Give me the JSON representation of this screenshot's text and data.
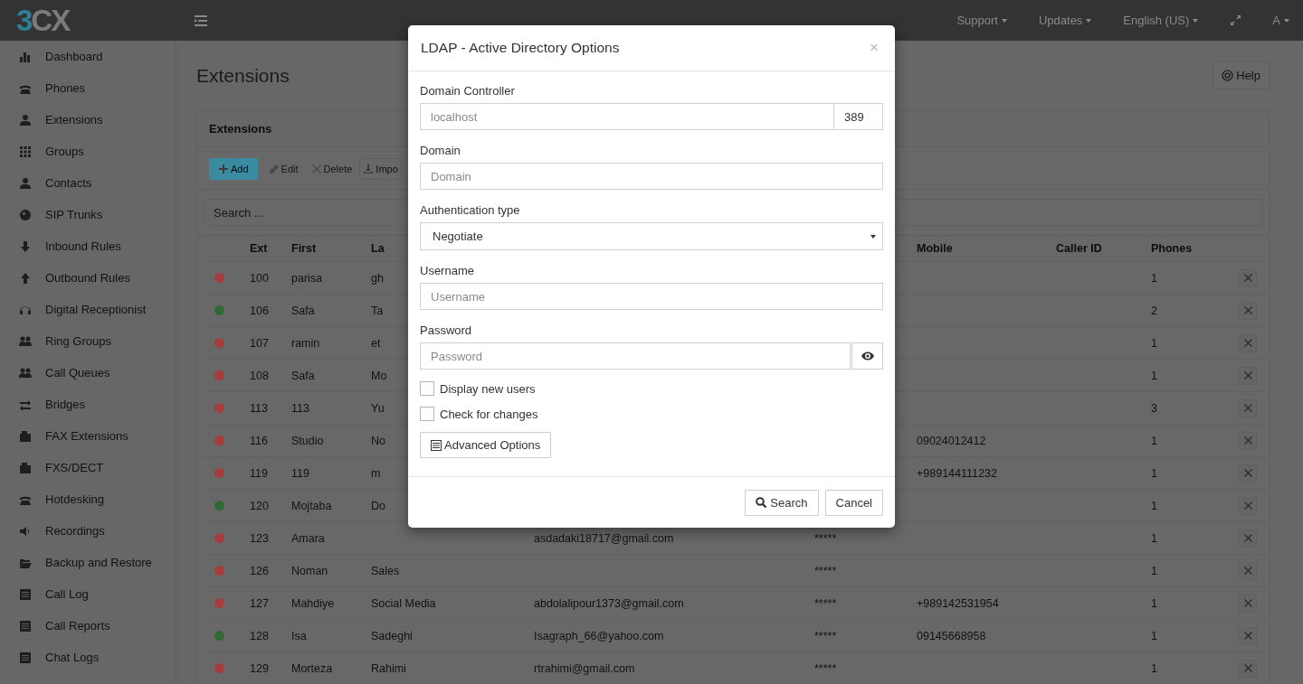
{
  "topbar": {
    "logo": [
      "3",
      "CX"
    ],
    "menus": [
      {
        "label": "Support"
      },
      {
        "label": "Updates"
      },
      {
        "label": "English (US)"
      },
      {
        "label": "A"
      }
    ]
  },
  "sidebar": {
    "items": [
      {
        "label": "Dashboard"
      },
      {
        "label": "Phones"
      },
      {
        "label": "Extensions"
      },
      {
        "label": "Groups"
      },
      {
        "label": "Contacts"
      },
      {
        "label": "SIP Trunks"
      },
      {
        "label": "Inbound Rules"
      },
      {
        "label": "Outbound Rules"
      },
      {
        "label": "Digital Receptionist"
      },
      {
        "label": "Ring Groups"
      },
      {
        "label": "Call Queues"
      },
      {
        "label": "Bridges"
      },
      {
        "label": "FAX Extensions"
      },
      {
        "label": "FXS/DECT"
      },
      {
        "label": "Hotdesking"
      },
      {
        "label": "Recordings"
      },
      {
        "label": "Backup and Restore"
      },
      {
        "label": "Call Log"
      },
      {
        "label": "Call Reports"
      },
      {
        "label": "Chat Logs"
      }
    ]
  },
  "page": {
    "title": "Extensions",
    "help_button": "Help"
  },
  "panel": {
    "title": "Extensions",
    "toolbar": [
      "Add",
      "Edit",
      "Delete",
      "Impo"
    ],
    "search": {
      "placeholder": "Search ..."
    }
  },
  "table": {
    "columns": [
      "Ext",
      "First",
      "La",
      "Mobile",
      "Caller ID",
      "Phones"
    ],
    "rows": [
      {
        "color": "#a63c3c",
        "ext": "100",
        "first": "parisa",
        "last": "gh",
        "email": "",
        "column_6": "",
        "mobile": "",
        "phones": "1"
      },
      {
        "color": "#2f6b32",
        "ext": "106",
        "first": "Safa",
        "last": "Ta",
        "email": "",
        "column_6": "",
        "mobile": "",
        "phones": "2"
      },
      {
        "color": "#a63c3c",
        "ext": "107",
        "first": "ramin",
        "last": "et",
        "email": "",
        "column_6": "",
        "mobile": "",
        "phones": "1"
      },
      {
        "color": "#a63c3c",
        "ext": "108",
        "first": "Safa",
        "last": "Mo",
        "email": "",
        "column_6": "",
        "mobile": "",
        "phones": "1"
      },
      {
        "color": "#a63c3c",
        "ext": "113",
        "first": "113",
        "last": "Yu",
        "email": "",
        "column_6": "",
        "mobile": "",
        "phones": "3"
      },
      {
        "color": "#a63c3c",
        "ext": "116",
        "first": "Studio",
        "last": "No",
        "email": "",
        "column_6": "",
        "mobile": "09024012412",
        "phones": "1"
      },
      {
        "color": "#a63c3c",
        "ext": "119",
        "first": "119",
        "last": "m",
        "email": "",
        "column_6": "",
        "mobile": "+989144111232",
        "phones": "1"
      },
      {
        "color": "#2f6b32",
        "ext": "120",
        "first": "Mojtaba",
        "last": "Do",
        "email": "",
        "column_6": "",
        "mobile": "",
        "phones": "1"
      },
      {
        "color": "#a63c3c",
        "ext": "123",
        "first": "Amara",
        "last": "",
        "email": "asdadaki18717@gmail.com",
        "column_6": "*****",
        "mobile": "",
        "phones": "1"
      },
      {
        "color": "#a63c3c",
        "ext": "126",
        "first": "Noman",
        "last": "Sales",
        "email": "",
        "column_6": "*****",
        "mobile": "",
        "phones": "1"
      },
      {
        "color": "#a63c3c",
        "ext": "127",
        "first": "Mahdiye",
        "last": "Social Media",
        "email": "abdolalipour1373@gmail.com",
        "column_6": "*****",
        "mobile": "+989142531954",
        "phones": "1"
      },
      {
        "color": "#2f6b32",
        "ext": "128",
        "first": "Isa",
        "last": "Sadeghi",
        "email": "Isagraph_66@yahoo.com",
        "column_6": "*****",
        "mobile": "09145668958",
        "phones": "1"
      },
      {
        "color": "#a63c3c",
        "ext": "129",
        "first": "Morteza",
        "last": "Rahimi",
        "email": "rtrahimi@gmail.com",
        "column_6": "*****",
        "mobile": "",
        "phones": "1"
      }
    ]
  },
  "dialog": {
    "title": "LDAP - Active Directory Options",
    "close": "×",
    "domain_controller": {
      "label": "Domain Controller",
      "placeholder": "localhost",
      "port": "389"
    },
    "domain": {
      "label": "Domain",
      "placeholder": "Domain"
    },
    "authentication_type": {
      "label": "Authentication type",
      "value": "Negotiate"
    },
    "username": {
      "label": "Username",
      "placeholder": "Username"
    },
    "password": {
      "label": "Password",
      "placeholder": "Password"
    },
    "checkboxes": [
      {
        "label": "Display new users",
        "checked": false
      },
      {
        "label": "Check for changes",
        "checked": false
      }
    ],
    "advanced_button": "Advanced Options",
    "buttons": [
      "Search",
      "Cancel"
    ]
  }
}
